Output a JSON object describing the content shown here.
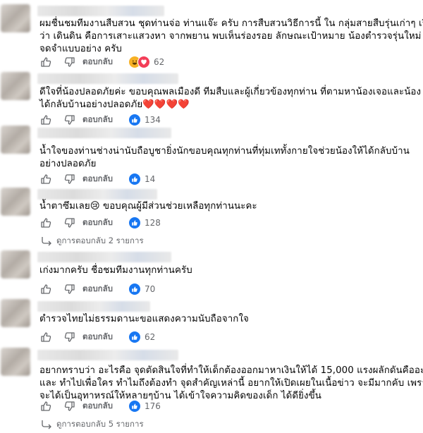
{
  "comments": [
    {
      "text_lines": [
        "ผมชื่นชมทีมงานสืบสวน ชุดท่านจ่อ ท่านแจ๊ะ ครับ การสืบสวนวิธีการนี้ ใน กลุ่มสายสืบรุ่นเก่าๆ เรียก",
        "ว่า เดินดิน คือการเสาะแสวงหา จากพยาน พบเห็นร่องรอย ลักษณะเป้าหมาย น้องตำรวจรุ่นใหม่ ควร",
        "จดจำแบบอย่าง ครับ"
      ],
      "reply_label": "ตอบกลับ",
      "reactions": [
        "haha",
        "love"
      ],
      "count": "62"
    },
    {
      "text_lines": [
        "ดีใจที่น้องปลอดภัยค่ะ ขอบคุณพลเมืองดี ทีมสืบและผู้เกี่ยวข้องทุกท่าน ที่ตามหาน้องเจอและน้อง",
        "ได้กลับบ้านอย่างปลอดภัย❤️❤️❤️❤️"
      ],
      "reply_label": "ตอบกลับ",
      "reactions": [
        "like"
      ],
      "count": "134"
    },
    {
      "text_lines": [
        "น้ำใจของท่านช่างน่านับถือบูชายิ่งนักขอบคุณทุกท่านที่ทุ่มเททั้งกายใจช่วยน้องให้ได้กลับบ้าน",
        "อย่างปลอดภัย"
      ],
      "reply_label": "ตอบกลับ",
      "reactions": [
        "like"
      ],
      "count": "14"
    },
    {
      "text_lines": [
        "น้ำตาซึมเลย😢 ขอบคุณผู้มีส่วนช่วยเหลือทุกท่านนะคะ"
      ],
      "reply_label": "ตอบกลับ",
      "reactions": [
        "like"
      ],
      "count": "128",
      "replies_link": "ดูการตอบกลับ 2 รายการ"
    },
    {
      "text_lines": [
        "เก่งมากครับ ชื่อชมทีมงานทุกท่านครับ"
      ],
      "reply_label": "ตอบกลับ",
      "reactions": [
        "like"
      ],
      "count": "70"
    },
    {
      "text_lines": [
        "ตำรวจไทยไม่ธรรมดานะขอแสดงความนับถือจากใจ"
      ],
      "reply_label": "ตอบกลับ",
      "reactions": [
        "like"
      ],
      "count": "62"
    },
    {
      "text_lines": [
        "อยากทราบว่า อะไรคือ จุดตัดสินใจที่ทำให้เด็กต้องออกมาหาเงินให้ได้ 15,000 แรงผลักดันคืออะไร",
        "และ ทำไปเพื่อใคร ทำไมถึงต้องทำ จุดสำคัญเหล่านี้ อยากให้เปิดเผยในเนื้อข่าว จะมีมากคับ เพราะ",
        "จะได้เป็นอุทาหรณ์ให้หลายๆบ้าน ได้เข้าใจความคิดของเด็ก ได้ดียิ่งขึ้น"
      ],
      "reply_label": "ตอบกลับ",
      "reactions": [
        "like"
      ],
      "count": "176",
      "replies_link": "ดูการตอบกลับ 5 รายการ"
    }
  ],
  "colors": {
    "like": "#1877f2",
    "love": "#f33e58",
    "haha": "#f7b125",
    "meta": "#65676b",
    "text": "#050505"
  },
  "icons": {
    "like_action": "thumbs-up-outline-icon",
    "dislike_action": "thumbs-down-outline-icon",
    "replies_arrow": "reply-arrow-icon"
  }
}
